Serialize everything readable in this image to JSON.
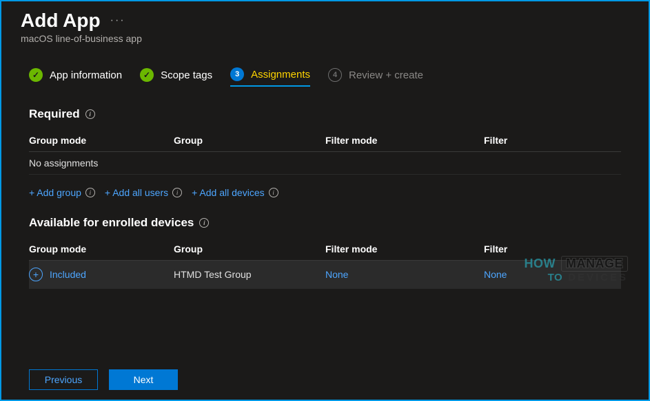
{
  "header": {
    "title": "Add App",
    "subtitle": "macOS line-of-business app"
  },
  "steps": [
    {
      "label": "App information",
      "state": "done"
    },
    {
      "label": "Scope tags",
      "state": "done"
    },
    {
      "label": "Assignments",
      "state": "active",
      "num": "3"
    },
    {
      "label": "Review + create",
      "state": "pending",
      "num": "4"
    }
  ],
  "sections": {
    "required": {
      "title": "Required",
      "columns": [
        "Group mode",
        "Group",
        "Filter mode",
        "Filter"
      ],
      "empty_text": "No assignments",
      "actions": {
        "add_group": "+ Add group",
        "add_all_users": "+ Add all users",
        "add_all_devices": "+ Add all devices"
      }
    },
    "available": {
      "title": "Available for enrolled devices",
      "columns": [
        "Group mode",
        "Group",
        "Filter mode",
        "Filter"
      ],
      "rows": [
        {
          "mode": "Included",
          "group": "HTMD Test Group",
          "filter_mode": "None",
          "filter": "None"
        }
      ]
    }
  },
  "footer": {
    "previous": "Previous",
    "next": "Next"
  },
  "watermark": {
    "line1_left": "HOW",
    "line1_right": "MANAGE",
    "line2_left": "TO",
    "line2_right": "DEVICES"
  }
}
